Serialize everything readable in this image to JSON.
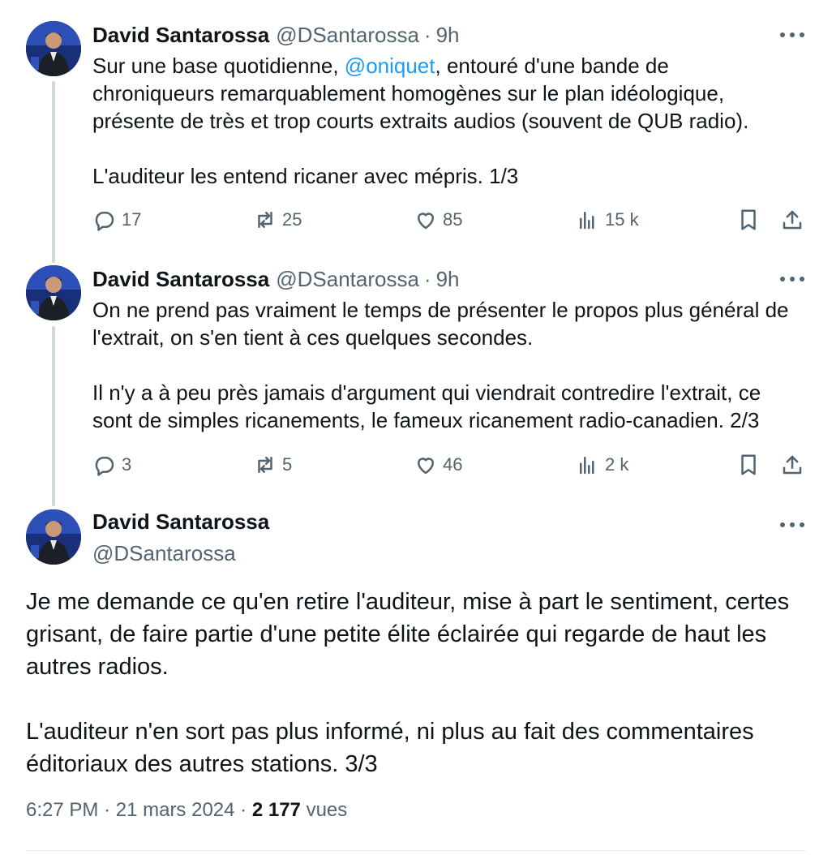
{
  "tweets": [
    {
      "name": "David Santarossa",
      "handle": "@DSantarossa",
      "separator": "·",
      "time": "9h",
      "lines": [
        {
          "before": "Sur une base quotidienne, ",
          "mention": "@oniquet",
          "after": ", entouré d'une bande de"
        },
        "chroniqueurs remarquablement homogènes sur le plan idéologique,",
        "présente de très et trop courts extraits audios (souvent de QUB radio).",
        "",
        "L'auditeur les entend ricaner avec mépris. 1/3"
      ],
      "replies": "17",
      "retweets": "25",
      "likes": "85",
      "views": "15 k"
    },
    {
      "name": "David Santarossa",
      "handle": "@DSantarossa",
      "separator": "·",
      "time": "9h",
      "lines": [
        "On ne prend pas vraiment le temps de présenter le propos plus général de",
        "l'extrait, on s'en tient à ces quelques secondes.",
        "",
        "Il n'y a à peu près jamais d'argument qui viendrait contredire l'extrait, ce",
        "sont de simples ricanements, le fameux ricanement radio-canadien. 2/3"
      ],
      "replies": "3",
      "retweets": "5",
      "likes": "46",
      "views": "2 k"
    }
  ],
  "main_tweet": {
    "name": "David Santarossa",
    "handle": "@DSantarossa",
    "lines": [
      "Je me demande ce qu'en retire l'auditeur, mise à part le sentiment, certes",
      "grisant, de faire partie d'une petite élite éclairée qui regarde de haut les",
      "autres radios.",
      "",
      "L'auditeur n'en sort pas plus informé, ni plus au fait des commentaires",
      "éditoriaux des autres stations. 3/3"
    ],
    "time": "6:27 PM",
    "separator": "·",
    "date": "21 mars 2024",
    "views_count": "2 177",
    "views_label": "vues"
  },
  "colors": {
    "text": "#0f1419",
    "secondary": "#536471",
    "link": "#1d9bf0",
    "thread_line": "#cfd9de"
  },
  "icons": [
    "reply-icon",
    "retweet-icon",
    "like-icon",
    "views-icon",
    "bookmark-icon",
    "share-icon",
    "more-icon"
  ]
}
